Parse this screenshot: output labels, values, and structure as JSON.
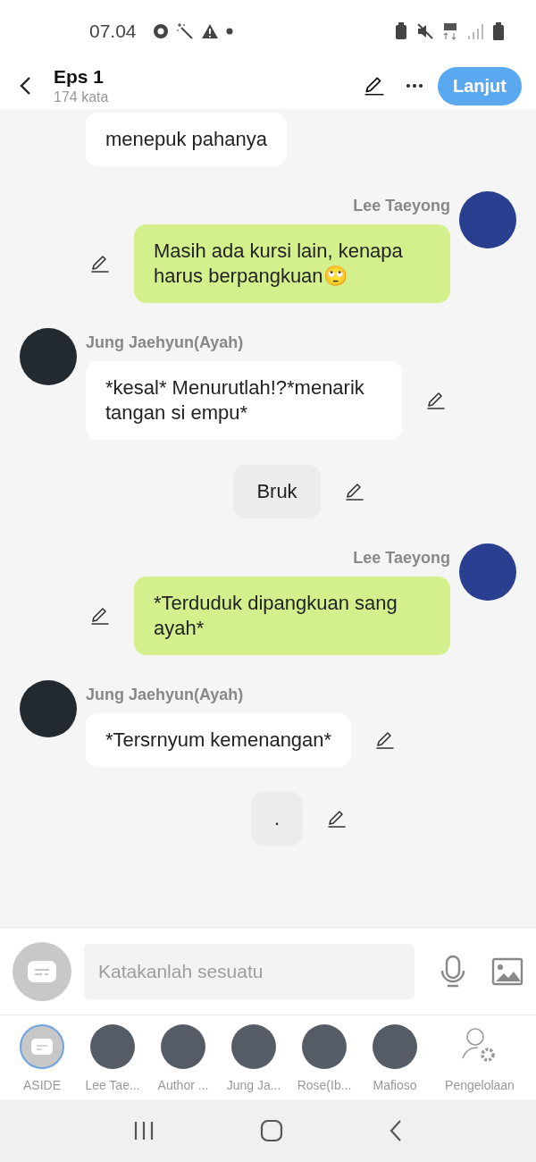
{
  "status_bar": {
    "time": "07.04"
  },
  "header": {
    "title": "Eps 1",
    "subtitle": "174 kata",
    "next_button": "Lanjut"
  },
  "messages": [
    {
      "kind": "left",
      "text": "menepuk pahanya"
    },
    {
      "kind": "right",
      "name": "Lee Taeyong",
      "text": "Masih ada kursi lain, kenapa harus berpangkuan🙄"
    },
    {
      "kind": "left",
      "name": "Jung Jaehyun(Ayah)",
      "text": "*kesal* Menurutlah!?*menarik tangan si empu*"
    },
    {
      "kind": "narration",
      "text": "Bruk"
    },
    {
      "kind": "right",
      "name": "Lee Taeyong",
      "text": "*Terduduk dipangkuan sang ayah*"
    },
    {
      "kind": "left",
      "name": "Jung Jaehyun(Ayah)",
      "text": "*Tersrnyum kemenangan*"
    },
    {
      "kind": "narration",
      "text": "."
    }
  ],
  "input": {
    "placeholder": "Katakanlah sesuatu"
  },
  "characters": [
    {
      "kind": "aside",
      "name": "ASIDE",
      "selected": true
    },
    {
      "kind": "avatar",
      "name": "Lee Tae...",
      "selected": false
    },
    {
      "kind": "avatar",
      "name": "Author ...",
      "selected": false
    },
    {
      "kind": "avatar",
      "name": "Jung Ja...",
      "selected": false
    },
    {
      "kind": "avatar",
      "name": "Rose(Ib...",
      "selected": false
    },
    {
      "kind": "avatar",
      "name": "Mafioso",
      "selected": false
    },
    {
      "kind": "manage",
      "name": "Pengelolaan",
      "selected": false
    }
  ]
}
